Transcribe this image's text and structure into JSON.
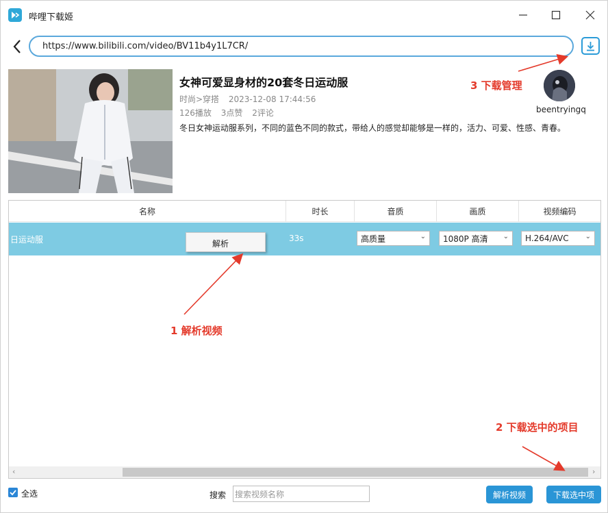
{
  "window": {
    "title": "哔哩下载姬",
    "controls": [
      "minimize",
      "maximize",
      "close"
    ]
  },
  "urlbar": {
    "url": "https://www.bilibili.com/video/BV11b4y1L7CR/"
  },
  "video": {
    "title": "女神可爱显身材的20套冬日运动服",
    "category": "时尚>穿搭",
    "datetime": "2023-12-08 17:44:56",
    "plays": "126播放",
    "likes": "3点赞",
    "comments": "2评论",
    "description": "冬日女神运动服系列，不同的蓝色不同的款式，带给人的感觉却能够是一样的，活力、可爱、性感、青春。",
    "uploader": "beentryingq"
  },
  "table": {
    "headers": [
      "名称",
      "时长",
      "音质",
      "画质",
      "视频编码"
    ],
    "rows": [
      {
        "name": "日运动服",
        "duration": "33s",
        "audio": "高质量",
        "video_quality": "1080P 高清",
        "codec": "H.264/AVC",
        "selected": true
      }
    ]
  },
  "context_menu": {
    "items": [
      "解析"
    ]
  },
  "annotations": {
    "a1": "1 解析视频",
    "a2": "2 下载选中的项目",
    "a3": "3 下载管理"
  },
  "footer": {
    "select_all_label": "全选",
    "select_all_checked": true,
    "search_label": "搜索",
    "search_placeholder": "搜索视频名称",
    "parse_button": "解析视频",
    "download_button": "下载选中项"
  },
  "colors": {
    "accent": "#2a95d6",
    "selected_row": "#7ecbe3",
    "annotation_red": "#e43a2b"
  }
}
